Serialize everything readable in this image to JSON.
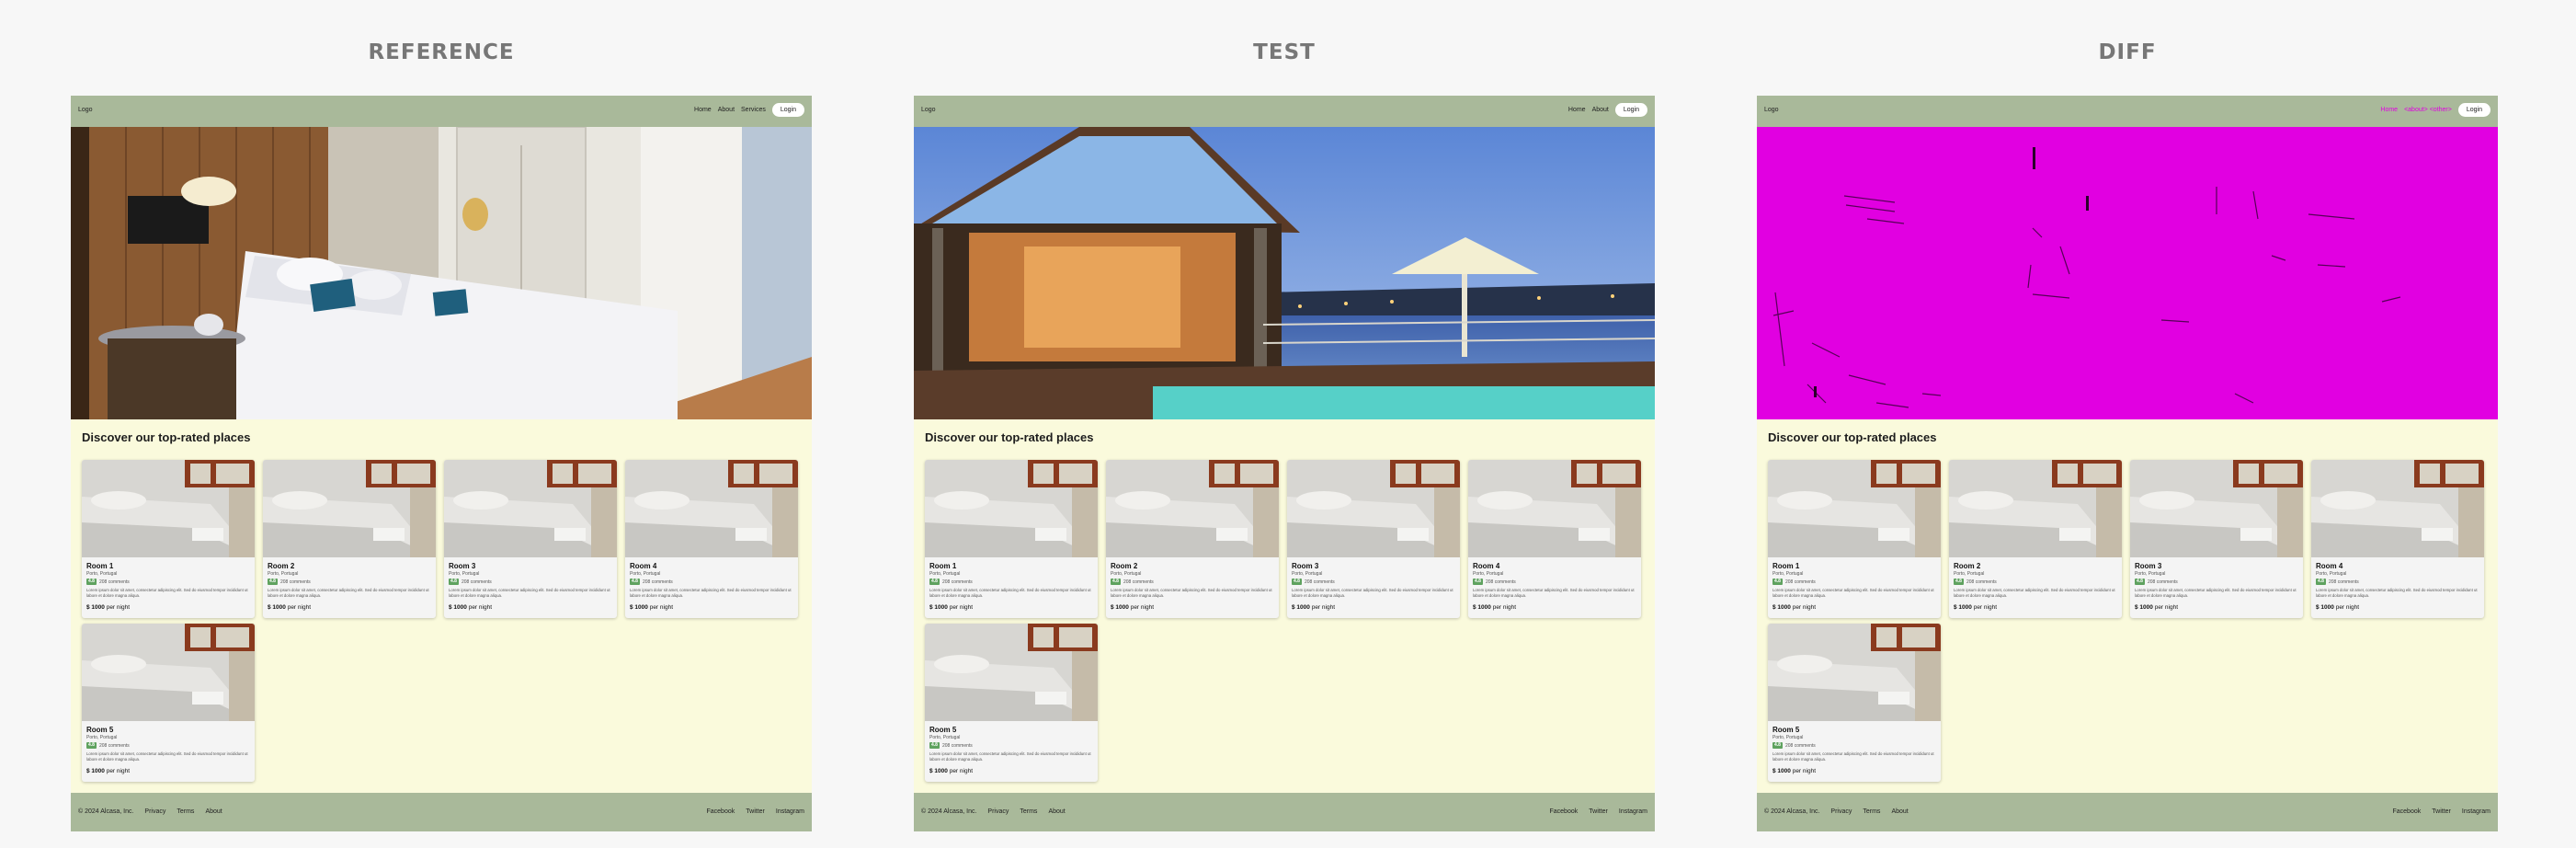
{
  "columns": [
    {
      "title": "REFERENCE"
    },
    {
      "title": "TEST"
    },
    {
      "title": "DIFF"
    }
  ],
  "site": {
    "logo": "Logo",
    "nav": {
      "reference": [
        "Home",
        "About",
        "Services"
      ],
      "test": [
        "Home",
        "About"
      ],
      "diff": [
        "Home",
        "<about> <other>"
      ]
    },
    "login": "Login",
    "section_title": "Discover our top-rated places",
    "footer": {
      "copyright": "© 2024 Alcasa, Inc.",
      "links": [
        "Privacy",
        "Terms",
        "About"
      ],
      "social": [
        "Facebook",
        "Twitter",
        "Instagram"
      ]
    }
  },
  "cards": [
    {
      "name": "Room 1",
      "location": "Porto, Portugal",
      "rating": "4.8",
      "comments": "208 comments",
      "price": "$ 1000",
      "per": "per night"
    },
    {
      "name": "Room 2",
      "location": "Porto, Portugal",
      "rating": "4.8",
      "comments": "208 comments",
      "price": "$ 1000",
      "per": "per night"
    },
    {
      "name": "Room 3",
      "location": "Porto, Portugal",
      "rating": "4.8",
      "comments": "208 comments",
      "price": "$ 1000",
      "per": "per night"
    },
    {
      "name": "Room 4",
      "location": "Porto, Portugal",
      "rating": "4.8",
      "comments": "208 comments",
      "price": "$ 1000",
      "per": "per night"
    },
    {
      "name": "Room 5",
      "location": "Porto, Portugal",
      "rating": "4.8",
      "comments": "208 comments",
      "price": "$ 1000",
      "per": "per night"
    }
  ],
  "card_description": "Lorem ipsum dolor sit amet, consectetur adipiscing elit. Sed do eiusmod tempor incididunt ut labore et dolore magna aliqua.",
  "colors": {
    "header": "#a9b99a",
    "page_bg": "#fafadc",
    "diff_highlight": "#e100e1",
    "rating_badge": "#5fa25f"
  }
}
